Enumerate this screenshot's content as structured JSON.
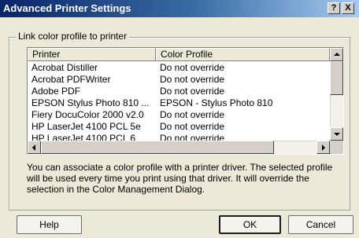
{
  "window": {
    "title": "Advanced Printer Settings",
    "help_button": "?",
    "close_button": "X"
  },
  "group": {
    "label": "Link color profile to printer"
  },
  "table": {
    "columns": [
      "Printer",
      "Color Profile"
    ],
    "rows": [
      {
        "printer": "Acrobat Distiller",
        "profile": "Do not override"
      },
      {
        "printer": "Acrobat PDFWriter",
        "profile": "Do not override"
      },
      {
        "printer": "Adobe PDF",
        "profile": "Do not override"
      },
      {
        "printer": "EPSON Stylus Photo 810 ...",
        "profile": "EPSON - Stylus Photo 810"
      },
      {
        "printer": "Fiery DocuColor 2000 v2.0",
        "profile": "Do not override"
      },
      {
        "printer": "HP LaserJet 4100 PCL 5e",
        "profile": "Do not override"
      },
      {
        "printer": "HP LaserJet 4100 PCL 6",
        "profile": "Do not override"
      }
    ]
  },
  "description": "You can associate a color profile with a printer driver. The selected profile will be used every time you print using that driver. It will override the selection in the Color Management Dialog.",
  "buttons": {
    "help": "Help",
    "ok": "OK",
    "cancel": "Cancel"
  }
}
